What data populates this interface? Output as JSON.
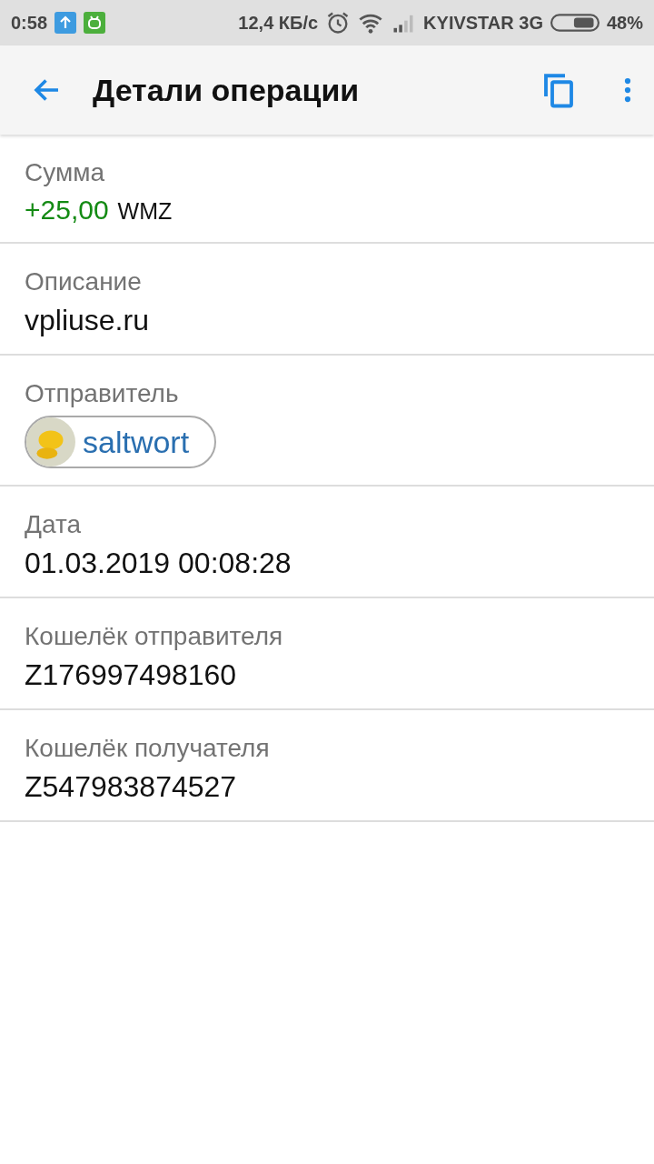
{
  "status_bar": {
    "time": "0:58",
    "speed": "12,4 КБ/с",
    "carrier": "KYIVSTAR 3G",
    "battery": "48%"
  },
  "app_bar": {
    "title": "Детали операции"
  },
  "fields": [
    {
      "kind": "amount",
      "label": "Сумма",
      "amount": "+25,00",
      "currency": "WMZ"
    },
    {
      "kind": "text",
      "label": "Описание",
      "value": "vpliuse.ru"
    },
    {
      "kind": "contact",
      "label": "Отправитель",
      "value": "saltwort"
    },
    {
      "kind": "text",
      "label": "Дата",
      "value": "01.03.2019 00:08:28"
    },
    {
      "kind": "text",
      "label": "Кошелёк отправителя",
      "value": "Z176997498160"
    },
    {
      "kind": "text",
      "label": "Кошелёк получателя",
      "value": "Z547983874527"
    }
  ]
}
